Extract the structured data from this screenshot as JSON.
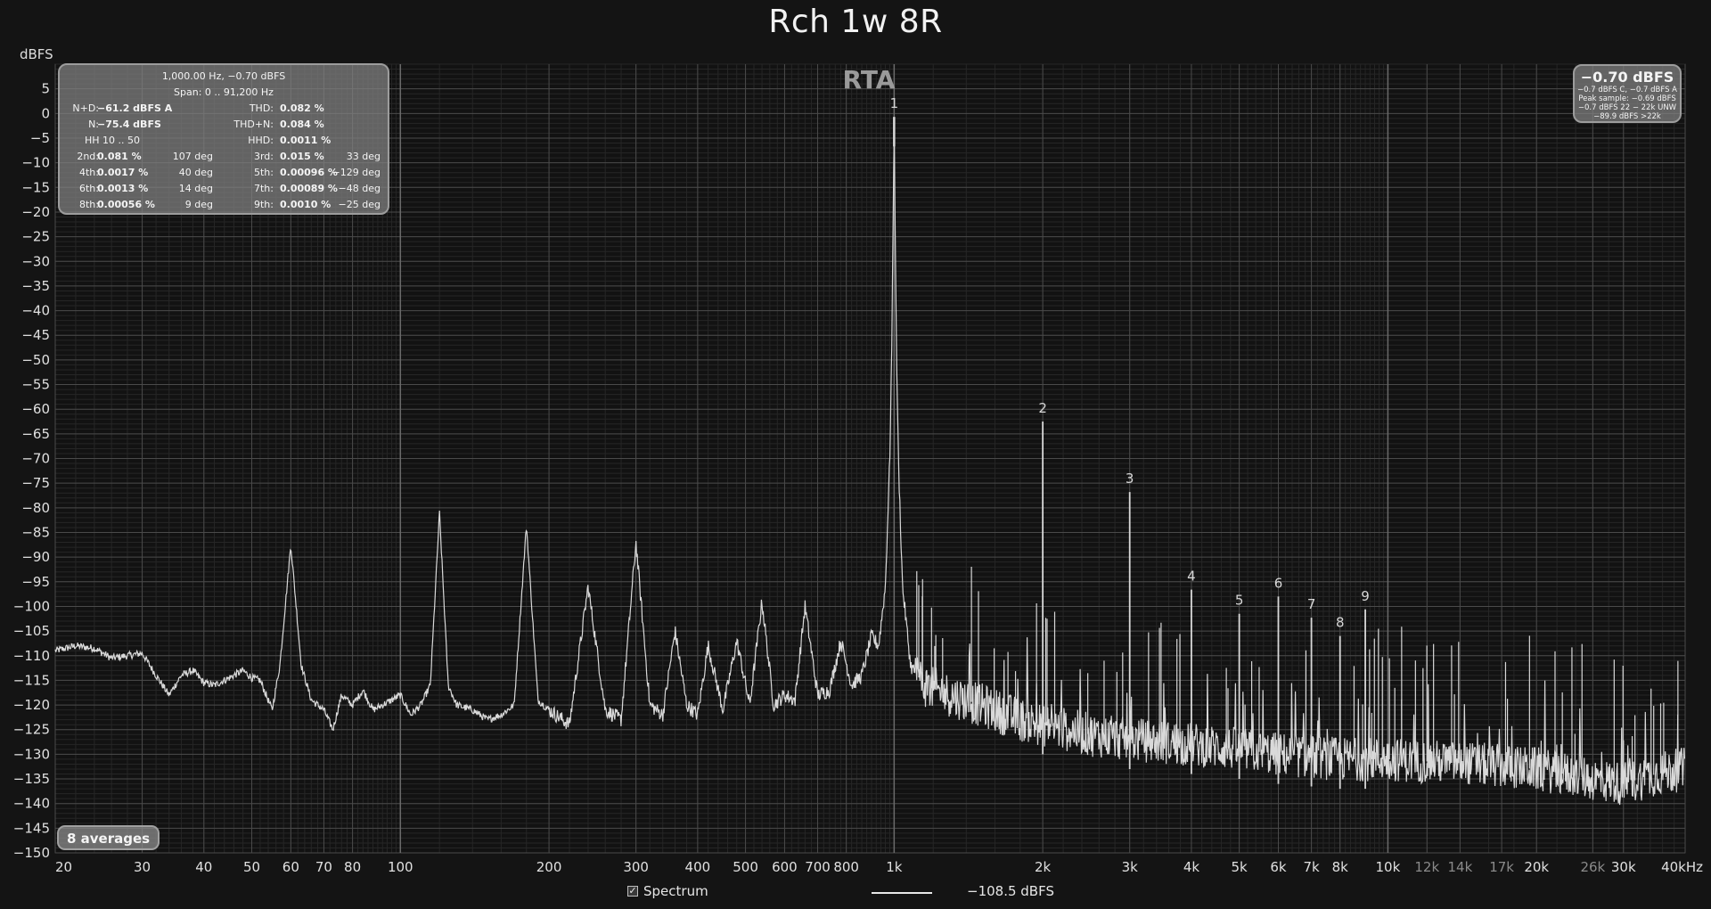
{
  "title": "Rch 1w 8R",
  "ylabel": "dBFS",
  "rta_label": "RTA",
  "info_box": {
    "line1": "1,000.00 Hz, −0.70 dBFS",
    "line2": "Span: 0 .. 91,200 Hz",
    "rows": [
      [
        {
          "label": "N+D:",
          "value": "−61.2 dBFS A"
        },
        {
          "label": "THD:",
          "value": "0.082 %"
        }
      ],
      [
        {
          "label": "N:",
          "value": "−75.4 dBFS"
        },
        {
          "label": "THD+N:",
          "value": "0.084 %"
        }
      ],
      [
        {
          "label": "HH 10 .. 50",
          "value": ""
        },
        {
          "label": "HHD:",
          "value": "0.0011 %"
        }
      ]
    ],
    "harmonics": [
      [
        {
          "label": "2nd:",
          "value": "0.081 %",
          "phase": "107 deg"
        },
        {
          "label": "3rd:",
          "value": "0.015 %",
          "phase": "33 deg"
        }
      ],
      [
        {
          "label": "4th:",
          "value": "0.0017 %",
          "phase": "40 deg"
        },
        {
          "label": "5th:",
          "value": "0.00096 %",
          "phase": "−129 deg"
        }
      ],
      [
        {
          "label": "6th:",
          "value": "0.0013 %",
          "phase": "14 deg"
        },
        {
          "label": "7th:",
          "value": "0.00089 %",
          "phase": "−48 deg"
        }
      ],
      [
        {
          "label": "8th:",
          "value": "0.00056 %",
          "phase": "9 deg"
        },
        {
          "label": "9th:",
          "value": "0.0010 %",
          "phase": "−25 deg"
        }
      ]
    ]
  },
  "level_box": {
    "main": "−0.70 dBFS",
    "sub1": "−0.7 dBFS C, −0.7 dBFS A",
    "sub2": "Peak sample: −0.69 dBFS",
    "sub3": "−0.7 dBFS 22 − 22k UNW",
    "sub4": "−89.9 dBFS >22k"
  },
  "averages_label": "8 averages",
  "legend": {
    "checkbox_mark": "✓",
    "spectrum_label": "Spectrum",
    "value": "−108.5 dBFS"
  },
  "colors": {
    "background": "#141414",
    "trace": "#d9d9d9",
    "grid_major": "#4a4a4a",
    "grid_minor": "#262626"
  },
  "chart_data": {
    "type": "line",
    "x_scale": "log",
    "xlim": [
      20,
      40000
    ],
    "ylim": [
      -150,
      10
    ],
    "grid": true,
    "y_ticks": [
      5,
      0,
      -5,
      -10,
      -15,
      -20,
      -25,
      -30,
      -35,
      -40,
      -45,
      -50,
      -55,
      -60,
      -65,
      -70,
      -75,
      -80,
      -85,
      -90,
      -95,
      -100,
      -105,
      -110,
      -115,
      -120,
      -125,
      -130,
      -135,
      -140,
      -145,
      -150
    ],
    "x_ticks": [
      {
        "value": 20,
        "label": "20"
      },
      {
        "value": 30,
        "label": "30"
      },
      {
        "value": 40,
        "label": "40"
      },
      {
        "value": 50,
        "label": "50"
      },
      {
        "value": 60,
        "label": "60"
      },
      {
        "value": 70,
        "label": "70"
      },
      {
        "value": 80,
        "label": "80"
      },
      {
        "value": 100,
        "label": "100"
      },
      {
        "value": 200,
        "label": "200"
      },
      {
        "value": 300,
        "label": "300"
      },
      {
        "value": 400,
        "label": "400"
      },
      {
        "value": 500,
        "label": "500"
      },
      {
        "value": 600,
        "label": "600"
      },
      {
        "value": 700,
        "label": "700"
      },
      {
        "value": 800,
        "label": "800"
      },
      {
        "value": 1000,
        "label": "1k"
      },
      {
        "value": 2000,
        "label": "2k"
      },
      {
        "value": 3000,
        "label": "3k"
      },
      {
        "value": 4000,
        "label": "4k"
      },
      {
        "value": 5000,
        "label": "5k"
      },
      {
        "value": 6000,
        "label": "6k"
      },
      {
        "value": 7000,
        "label": "7k"
      },
      {
        "value": 8000,
        "label": "8k"
      },
      {
        "value": 10000,
        "label": "10k"
      },
      {
        "value": 12000,
        "label": "12k",
        "minor": true
      },
      {
        "value": 14000,
        "label": "14k",
        "minor": true
      },
      {
        "value": 17000,
        "label": "17k",
        "minor": true
      },
      {
        "value": 20000,
        "label": "20k"
      },
      {
        "value": 26000,
        "label": "26k",
        "minor": true
      },
      {
        "value": 30000,
        "label": "30k"
      },
      {
        "value": 40000,
        "label": "40kHz"
      }
    ],
    "harmonic_markers": [
      {
        "label": "1",
        "x": 1000,
        "y": -0.7
      },
      {
        "label": "2",
        "x": 2000,
        "y": -62.5
      },
      {
        "label": "3",
        "x": 3000,
        "y": -76.8
      },
      {
        "label": "4",
        "x": 4000,
        "y": -96.6
      },
      {
        "label": "5",
        "x": 5000,
        "y": -101.5
      },
      {
        "label": "6",
        "x": 6000,
        "y": -98.0
      },
      {
        "label": "7",
        "x": 7000,
        "y": -102.3
      },
      {
        "label": "8",
        "x": 8000,
        "y": -106.0
      },
      {
        "label": "9",
        "x": 9000,
        "y": -100.6
      }
    ],
    "hum_peaks": [
      {
        "x": 60,
        "y": -87.5
      },
      {
        "x": 120,
        "y": -81
      },
      {
        "x": 180,
        "y": -83.5
      },
      {
        "x": 240,
        "y": -96
      },
      {
        "x": 300,
        "y": -87
      },
      {
        "x": 360,
        "y": -105
      },
      {
        "x": 420,
        "y": -108
      },
      {
        "x": 480,
        "y": -107
      },
      {
        "x": 540,
        "y": -99
      },
      {
        "x": 660,
        "y": -100
      },
      {
        "x": 780,
        "y": -107
      },
      {
        "x": 900,
        "y": -106
      }
    ],
    "series": [
      {
        "points": [
          [
            20,
            -109
          ],
          [
            22,
            -108
          ],
          [
            24,
            -108.5
          ],
          [
            26,
            -110.5
          ],
          [
            28,
            -110
          ],
          [
            30,
            -109.5
          ],
          [
            32,
            -114
          ],
          [
            34,
            -118
          ],
          [
            36,
            -114
          ],
          [
            38,
            -113
          ],
          [
            40,
            -115.5
          ],
          [
            42,
            -116
          ],
          [
            45,
            -114.5
          ],
          [
            48,
            -113
          ],
          [
            50,
            -114.5
          ],
          [
            52,
            -115
          ],
          [
            55,
            -121
          ],
          [
            57,
            -112
          ],
          [
            60,
            -87.5
          ],
          [
            63,
            -112
          ],
          [
            66,
            -119
          ],
          [
            70,
            -121
          ],
          [
            73,
            -125
          ],
          [
            76,
            -118
          ],
          [
            80,
            -120
          ],
          [
            84,
            -117
          ],
          [
            88,
            -121
          ],
          [
            92,
            -120
          ],
          [
            96,
            -119
          ],
          [
            100,
            -118
          ],
          [
            105,
            -122
          ],
          [
            110,
            -120
          ],
          [
            115,
            -116
          ],
          [
            120,
            -81
          ],
          [
            125,
            -116
          ],
          [
            130,
            -120
          ],
          [
            140,
            -121
          ],
          [
            150,
            -123
          ],
          [
            160,
            -122
          ],
          [
            170,
            -120
          ],
          [
            180,
            -83.5
          ],
          [
            190,
            -119
          ],
          [
            200,
            -121
          ],
          [
            220,
            -124
          ],
          [
            240,
            -96
          ],
          [
            260,
            -121
          ],
          [
            280,
            -123
          ],
          [
            300,
            -87
          ],
          [
            320,
            -120
          ],
          [
            340,
            -122
          ],
          [
            360,
            -105
          ],
          [
            380,
            -120
          ],
          [
            400,
            -122
          ],
          [
            420,
            -108
          ],
          [
            450,
            -121
          ],
          [
            480,
            -107
          ],
          [
            510,
            -120
          ],
          [
            540,
            -99
          ],
          [
            570,
            -120
          ],
          [
            600,
            -118
          ],
          [
            630,
            -119
          ],
          [
            660,
            -100
          ],
          [
            700,
            -118
          ],
          [
            740,
            -117
          ],
          [
            780,
            -107
          ],
          [
            820,
            -116
          ],
          [
            860,
            -114
          ],
          [
            900,
            -106
          ],
          [
            930,
            -108
          ],
          [
            960,
            -96
          ],
          [
            980,
            -70
          ],
          [
            990,
            -45
          ],
          [
            1000,
            -0.7
          ],
          [
            1010,
            -45
          ],
          [
            1020,
            -70
          ],
          [
            1040,
            -96
          ],
          [
            1080,
            -112
          ],
          [
            1150,
            -116
          ],
          [
            1300,
            -118
          ],
          [
            1500,
            -120
          ],
          [
            1800,
            -123
          ],
          [
            2000,
            -124
          ],
          [
            2500,
            -126
          ],
          [
            3000,
            -127
          ],
          [
            4000,
            -128
          ],
          [
            5000,
            -129
          ],
          [
            6000,
            -130
          ],
          [
            8000,
            -131
          ],
          [
            10000,
            -131
          ],
          [
            15000,
            -132
          ],
          [
            20000,
            -133
          ],
          [
            26000,
            -135
          ],
          [
            30000,
            -136
          ],
          [
            35000,
            -134
          ],
          [
            40000,
            -133
          ]
        ]
      }
    ]
  }
}
